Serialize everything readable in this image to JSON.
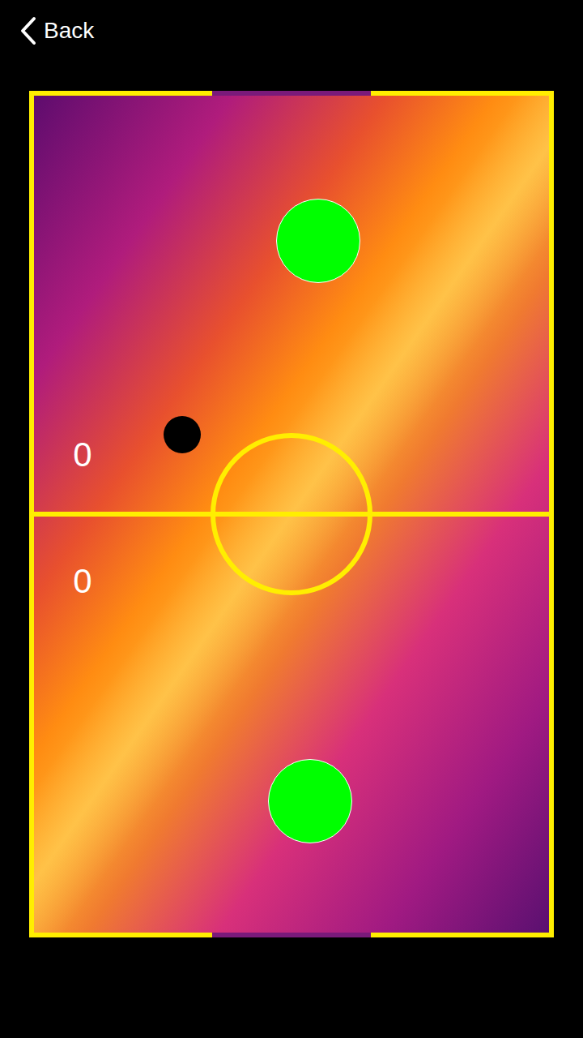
{
  "nav": {
    "back": "Back"
  },
  "scores": [
    {
      "player": "top",
      "value": "0"
    },
    {
      "player": "bottom",
      "value": "0"
    }
  ]
}
